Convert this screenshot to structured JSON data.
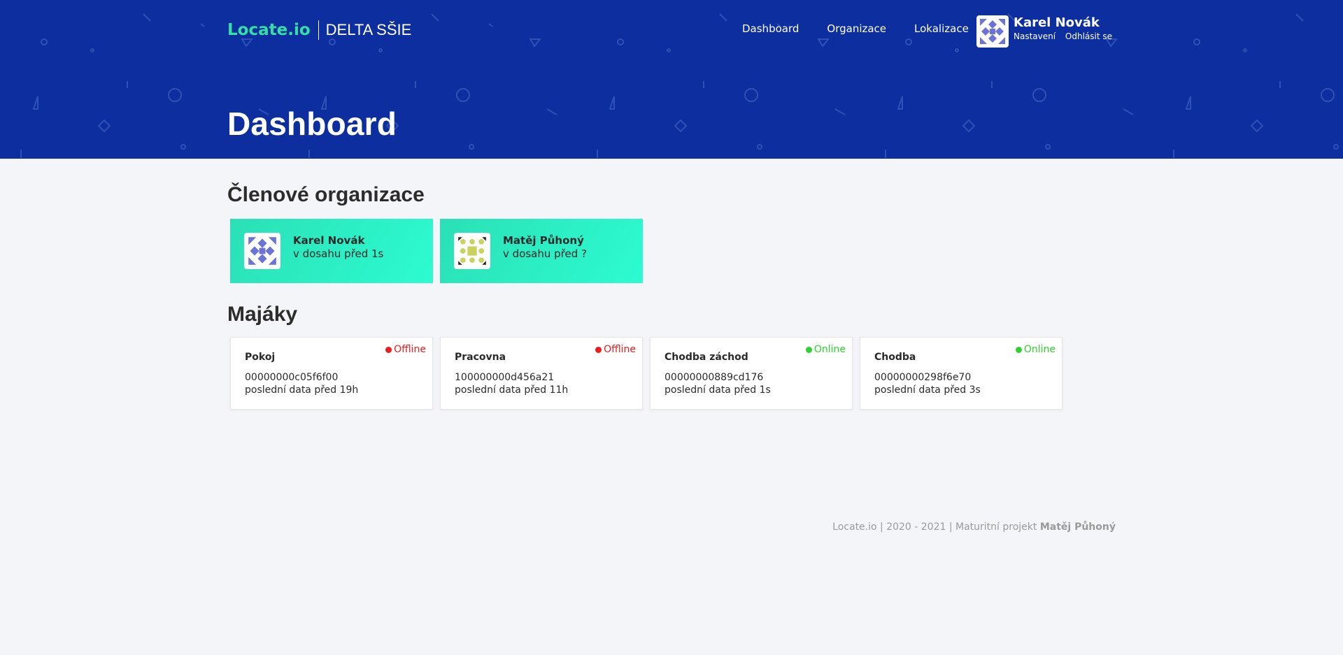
{
  "header": {
    "brand": "Locate.io",
    "organization": "DELTA SŠIE",
    "nav": [
      {
        "label": "Dashboard"
      },
      {
        "label": "Organizace"
      },
      {
        "label": "Lokalizace"
      }
    ],
    "user": {
      "name": "Karel Novák",
      "settings_label": "Nastavení",
      "logout_label": "Odhlásit se"
    },
    "page_title": "Dashboard"
  },
  "members": {
    "title": "Členové organizace",
    "items": [
      {
        "name": "Karel Novák",
        "seen": "v dosahu před 1s",
        "avatar_color": "#6c73d6"
      },
      {
        "name": "Matěj Půhoný",
        "seen": "v dosahu před ?",
        "avatar_color": "#c9d25c"
      }
    ]
  },
  "beacons": {
    "title": "Majáky",
    "items": [
      {
        "name": "Pokoj",
        "status": "Offline",
        "status_color": "#f01b1b",
        "id": "00000000c05f6f00",
        "last": "poslední data před 19h"
      },
      {
        "name": "Pracovna",
        "status": "Offline",
        "status_color": "#f01b1b",
        "id": "100000000d456a21",
        "last": "poslední data před 11h"
      },
      {
        "name": "Chodba záchod",
        "status": "Online",
        "status_color": "#2fd12f",
        "id": "00000000889cd176",
        "last": "poslední data před 1s"
      },
      {
        "name": "Chodba",
        "status": "Online",
        "status_color": "#2fd12f",
        "id": "00000000298f6e70",
        "last": "poslední data před 3s"
      }
    ]
  },
  "footer": {
    "text": "Locate.io | 2020 - 2021 | Maturitní projekt",
    "author": "Matěj Půhoný"
  },
  "colors": {
    "hero_bg": "#0c2e9e",
    "brand": "#33e0a3",
    "member_card": "#2dfbd1",
    "offline": "#f01b1b",
    "online": "#2fd12f"
  }
}
